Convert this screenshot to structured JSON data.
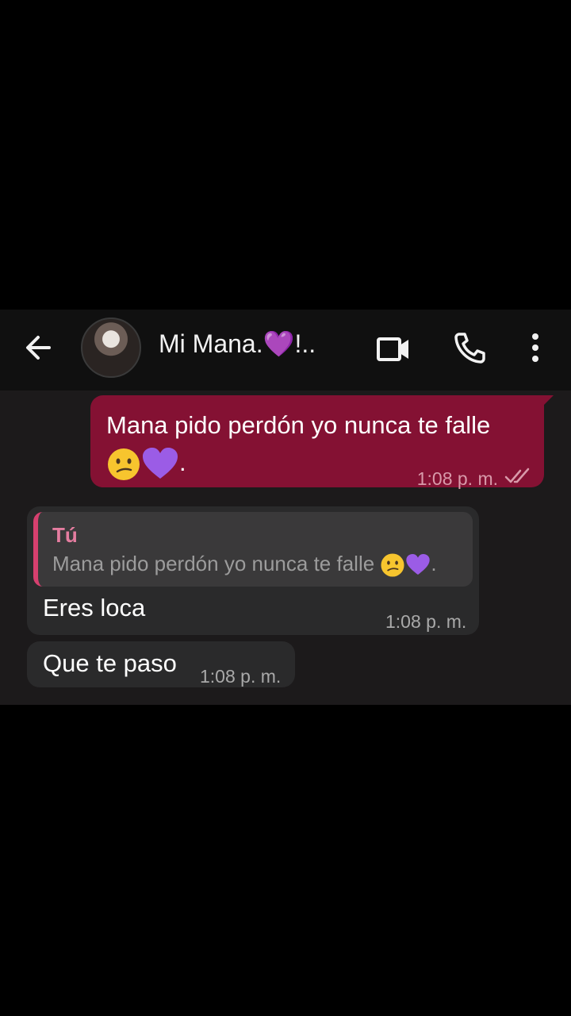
{
  "header": {
    "contact_name": "Mi Mana.💜!..",
    "back_icon": "arrow-left-icon",
    "video_icon": "video-call-icon",
    "call_icon": "phone-icon",
    "menu_icon": "more-vertical-icon"
  },
  "messages": {
    "outgoing": {
      "text_main": "Mana pido perdón yo nunca te falle",
      "text_tail": ".",
      "time": "1:08 p. m.",
      "status_icon": "double-check-icon"
    },
    "reply": {
      "quoted_author": "Tú",
      "quoted_text_main": "Mana pido perdón yo nunca te falle",
      "quoted_text_tail": ".",
      "text": "Eres loca",
      "time": "1:08 p. m."
    },
    "incoming2": {
      "text": "Que te paso",
      "time": "1:08 p. m."
    }
  },
  "colors": {
    "outgoing_bubble": "#841133",
    "incoming_bubble": "#2a2a2b",
    "quote_accent": "#d6406f"
  }
}
